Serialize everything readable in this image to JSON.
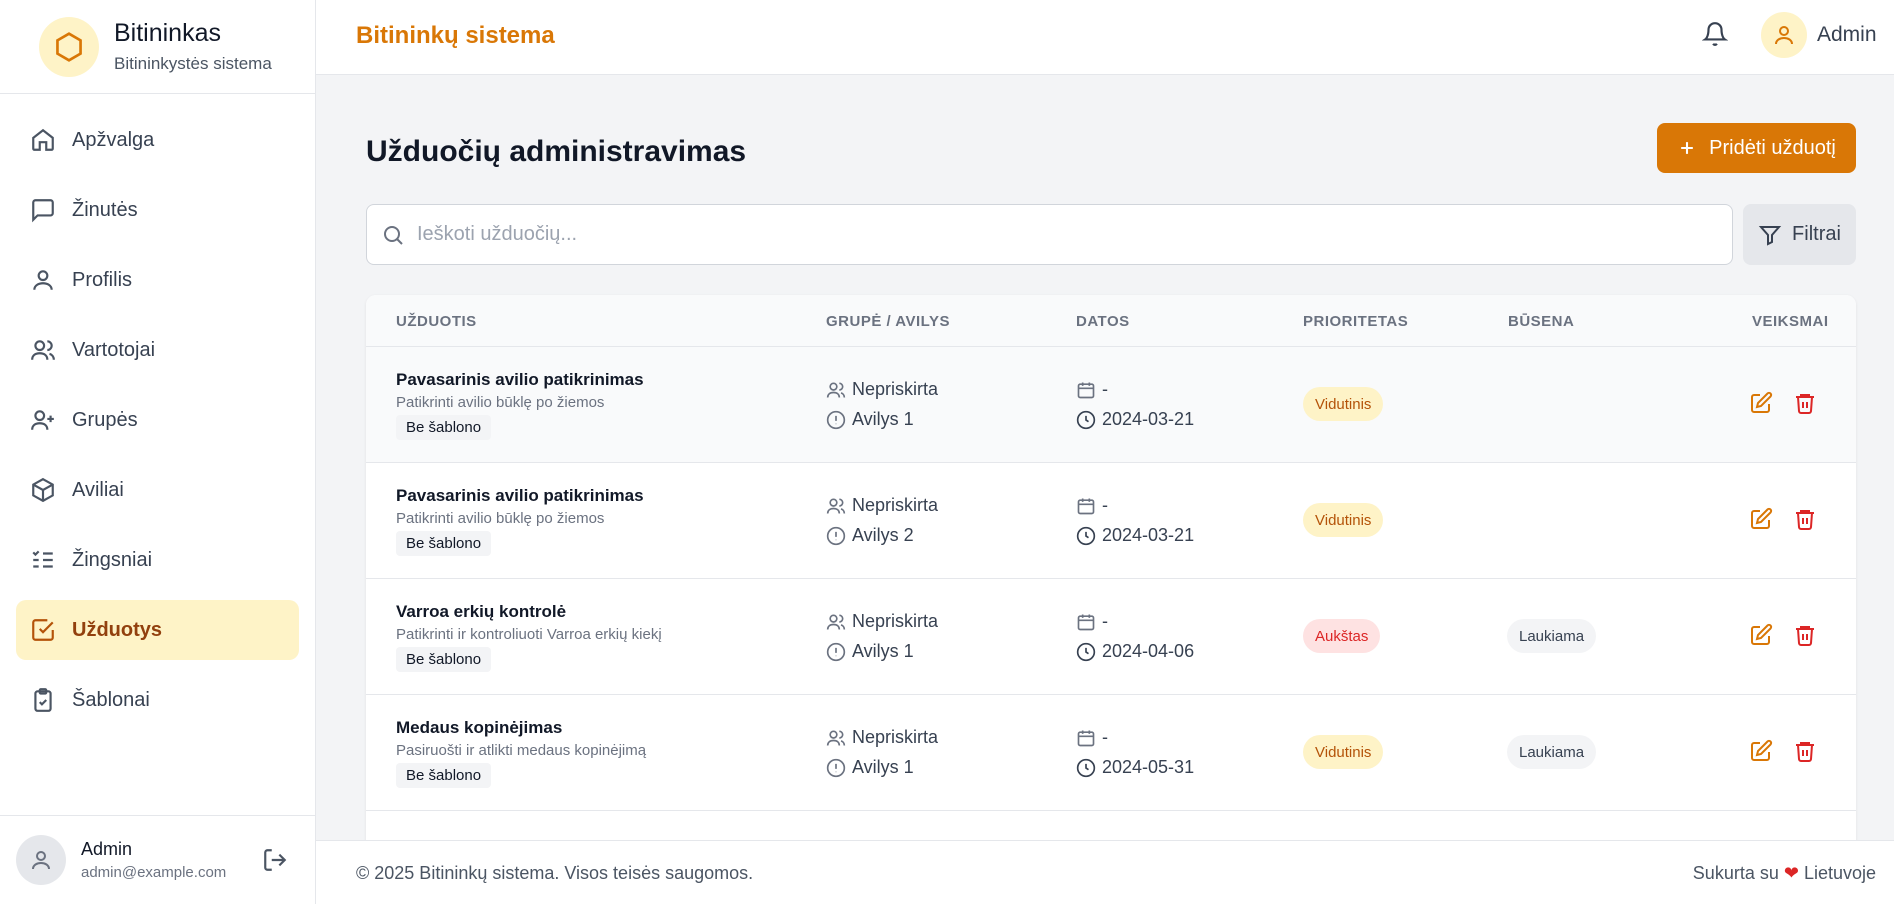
{
  "sidebar": {
    "brand_name": "Bitininkas",
    "brand_subtitle": "Bitininkystės sistema",
    "items": [
      {
        "label": "Apžvalga",
        "icon": "home-icon"
      },
      {
        "label": "Žinutės",
        "icon": "message-icon"
      },
      {
        "label": "Profilis",
        "icon": "user-icon"
      },
      {
        "label": "Vartotojai",
        "icon": "users-icon"
      },
      {
        "label": "Grupės",
        "icon": "user-plus-icon"
      },
      {
        "label": "Aviliai",
        "icon": "box-icon"
      },
      {
        "label": "Žingsniai",
        "icon": "list-checks-icon"
      },
      {
        "label": "Užduotys",
        "icon": "checkbox-icon",
        "active": true
      },
      {
        "label": "Šablonai",
        "icon": "clipboard-icon"
      }
    ],
    "user": {
      "name": "Admin",
      "email": "admin@example.com"
    }
  },
  "header": {
    "title": "Bitininkų sistema",
    "user_name": "Admin"
  },
  "main": {
    "page_title": "Užduočių administravimas",
    "add_button": "Pridėti užduotį",
    "search_placeholder": "Ieškoti užduočių...",
    "filter_button": "Filtrai",
    "columns": [
      "UŽDUOTIS",
      "GRUPĖ / AVILYS",
      "DATOS",
      "PRIORITETAS",
      "BŪSENA",
      "VEIKSMAI"
    ],
    "rows": [
      {
        "title": "Pavasarinis avilio patikrinimas",
        "desc": "Patikrinti avilio būklę po žiemos",
        "tag": "Be šablono",
        "group": "Nepriskirta",
        "hive": "Avilys 1",
        "start": "-",
        "due": "2024-03-21",
        "priority": "Vidutinis",
        "priority_level": "medium",
        "status": ""
      },
      {
        "title": "Pavasarinis avilio patikrinimas",
        "desc": "Patikrinti avilio būklę po žiemos",
        "tag": "Be šablono",
        "group": "Nepriskirta",
        "hive": "Avilys 2",
        "start": "-",
        "due": "2024-03-21",
        "priority": "Vidutinis",
        "priority_level": "medium",
        "status": ""
      },
      {
        "title": "Varroa erkių kontrolė",
        "desc": "Patikrinti ir kontroliuoti Varroa erkių kiekį",
        "tag": "Be šablono",
        "group": "Nepriskirta",
        "hive": "Avilys 1",
        "start": "-",
        "due": "2024-04-06",
        "priority": "Aukštas",
        "priority_level": "high",
        "status": "Laukiama"
      },
      {
        "title": "Medaus kopinėjimas",
        "desc": "Pasiruošti ir atlikti medaus kopinėjimą",
        "tag": "Be šablono",
        "group": "Nepriskirta",
        "hive": "Avilys 1",
        "start": "-",
        "due": "2024-05-31",
        "priority": "Vidutinis",
        "priority_level": "medium",
        "status": "Laukiama"
      }
    ]
  },
  "footer": {
    "copyright": "© 2025 Bitininkų sistema. Visos teisės saugomos.",
    "made_prefix": "Sukurta su",
    "made_suffix": "Lietuvoje"
  },
  "colors": {
    "accent": "#d97706",
    "accent_light": "#fef3c7",
    "danger": "#dc2626"
  }
}
